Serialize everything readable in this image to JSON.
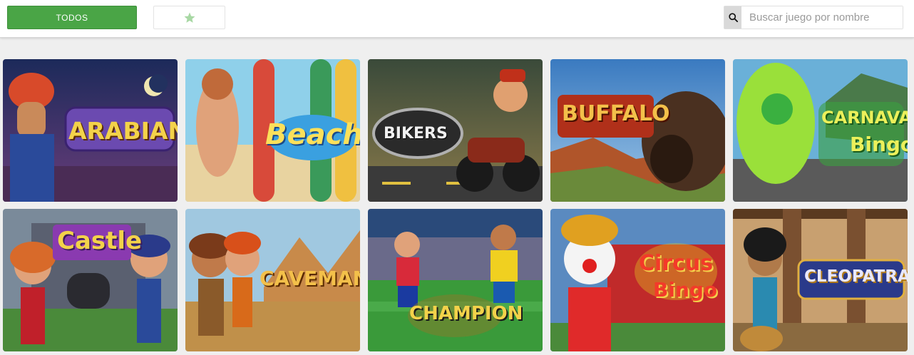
{
  "toolbar": {
    "all_label": "TODOS",
    "favorites_icon": "star-icon",
    "accent_color": "#4aa546"
  },
  "search": {
    "placeholder": "Buscar juego por nombre",
    "icon": "search-icon"
  },
  "games": [
    {
      "title": "ARABIAN"
    },
    {
      "title": "Beach"
    },
    {
      "title": "BIKERS"
    },
    {
      "title": "BUFFALO"
    },
    {
      "title": "CARNAVAL",
      "subtitle": "Bingo"
    },
    {
      "title": "Castle"
    },
    {
      "title": "CAVEMAN"
    },
    {
      "title": "CHAMPION"
    },
    {
      "title": "Circus",
      "subtitle": "Bingo"
    },
    {
      "title": "CLEOPATRA"
    }
  ]
}
